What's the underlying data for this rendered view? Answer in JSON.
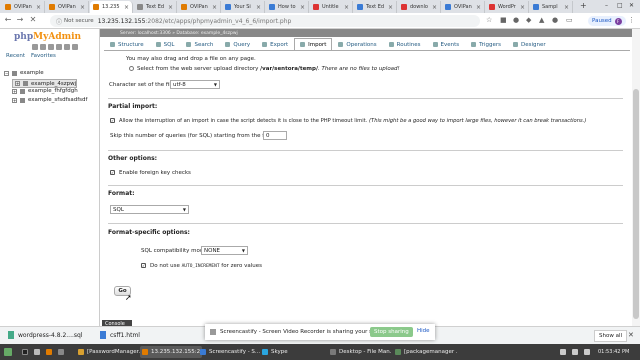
{
  "browser": {
    "tabs": [
      {
        "label": "OVIPan",
        "fav": "#e07b00"
      },
      {
        "label": "OVIPan",
        "fav": "#e07b00"
      },
      {
        "label": "13.235",
        "fav": "#e07b00",
        "active": true
      },
      {
        "label": "Text Ed",
        "fav": "#888888"
      },
      {
        "label": "OVIPan",
        "fav": "#e07b00"
      },
      {
        "label": "Your Si",
        "fav": "#3a7bd5"
      },
      {
        "label": "How to",
        "fav": "#3a7bd5"
      },
      {
        "label": "Untitle",
        "fav": "#d33"
      },
      {
        "label": "Text Ed",
        "fav": "#3a7bd5"
      },
      {
        "label": "downlo",
        "fav": "#d33"
      },
      {
        "label": "OVIPan",
        "fav": "#3a7bd5"
      },
      {
        "label": "WordPr",
        "fav": "#d33"
      },
      {
        "label": "Sampl",
        "fav": "#3a7bd5"
      }
    ],
    "not_secure": "Not secure",
    "url_host": "13.235.132.155",
    "url_path": ":2082/etc/apps/phpmyadmin_v4_6_6/import.php",
    "paused_label": "Paused",
    "profile_initial": "F"
  },
  "pma": {
    "logo_php": "php",
    "logo_myadmin": "MyAdmin",
    "nav_tabs": [
      "Recent",
      "Favorites"
    ],
    "tree": [
      {
        "label": "example",
        "pm": "−"
      },
      {
        "label": "example_4szpwj",
        "pm": "+",
        "selected": true
      },
      {
        "label": "example_fhfgfdgh",
        "pm": "+"
      },
      {
        "label": "example_sfsdfsadfsdf",
        "pm": "+"
      }
    ],
    "breadcrumb": "Server: localhost:3306 » Database: example_4szpwj",
    "tabs": [
      {
        "label": "Structure"
      },
      {
        "label": "SQL"
      },
      {
        "label": "Search"
      },
      {
        "label": "Query"
      },
      {
        "label": "Export"
      },
      {
        "label": "Import",
        "active": true
      },
      {
        "label": "Operations"
      },
      {
        "label": "Routines"
      },
      {
        "label": "Events"
      },
      {
        "label": "Triggers"
      },
      {
        "label": "Designer"
      }
    ]
  },
  "form": {
    "drag_drop_text": "You may also drag and drop a file on any page.",
    "upload_dir_prefix": "Select from the web server upload directory ",
    "upload_dir_path": "/var/sentora/temp/",
    "upload_dir_suffix": ". There are no files to upload!",
    "charset_label": "Character set of the file:",
    "charset_value": "utf-8",
    "partial_import_header": "Partial import:",
    "allow_interrupt": "Allow the interruption of an import in case the script detects it is close to the PHP timeout limit. ",
    "allow_interrupt_note": "(This might be a good way to import large files, however it can break transactions.)",
    "skip_queries_label": "Skip this number of queries (for SQL) starting from the first one:",
    "skip_queries_value": "0",
    "other_options_header": "Other options:",
    "foreign_keys_label": "Enable foreign key checks",
    "format_header": "Format:",
    "format_value": "SQL",
    "format_specific_header": "Format-specific options:",
    "sql_compat_label": "SQL compatibility mode:",
    "sql_compat_value": "NONE",
    "no_auto_inc_prefix": "Do not use ",
    "no_auto_inc_code": "AUTO_INCREMENT",
    "no_auto_inc_suffix": " for zero values",
    "go_label": "Go",
    "console_label": "Console"
  },
  "downloads": {
    "items": [
      {
        "label": "wordpress-4.8.2....sql"
      },
      {
        "label": "csff1.html"
      }
    ],
    "show_all": "Show all"
  },
  "banner": {
    "text": "Screencastify - Screen Video Recorder is sharing your screen.",
    "stop_label": "Stop sharing",
    "hide_label": "Hide"
  },
  "taskbar": {
    "items": [
      {
        "label": "[PasswordManager...",
        "color": "#d8a030"
      },
      {
        "label": "13.235.132.155:2...",
        "color": "#e07b00",
        "active": true
      },
      {
        "label": "Screencastify - S...",
        "color": "#3a7bd5"
      },
      {
        "label": "Skype",
        "color": "#2aa6e0"
      },
      {
        "label": "Desktop - File Man...",
        "color": "#7a7a7a"
      },
      {
        "label": "[packagemanager ...",
        "color": "#5a8a5a"
      }
    ],
    "clock": "01:53:42 PM"
  }
}
